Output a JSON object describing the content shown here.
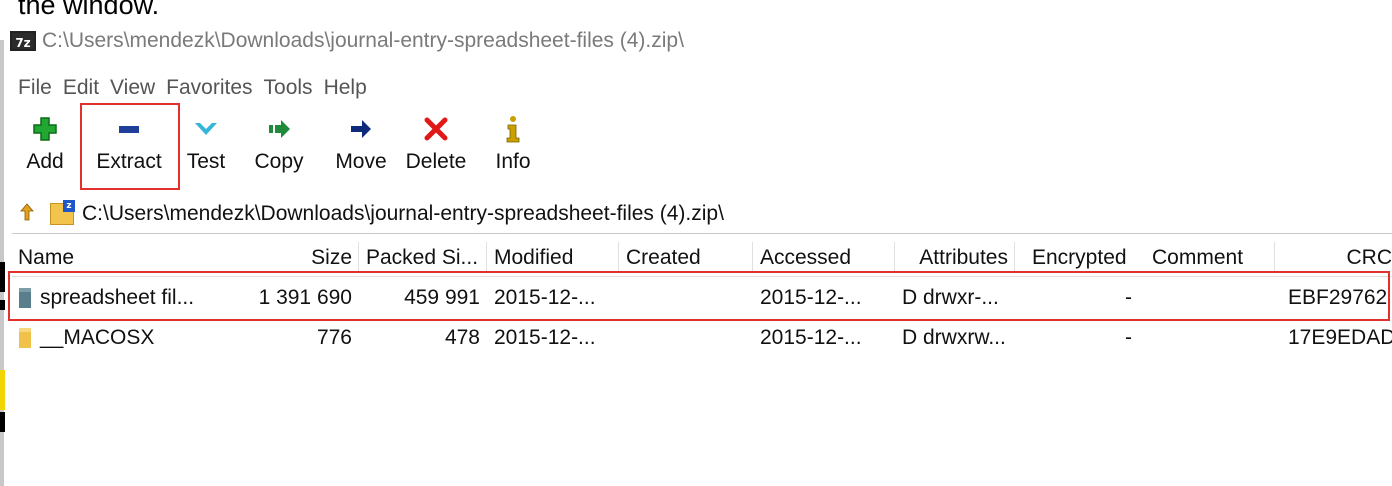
{
  "caption": "the window.",
  "window": {
    "app_icon_text": "7z",
    "title": "C:\\Users\\mendezk\\Downloads\\journal-entry-spreadsheet-files (4).zip\\"
  },
  "menu": [
    "File",
    "Edit",
    "View",
    "Favorites",
    "Tools",
    "Help"
  ],
  "toolbar": {
    "add": "Add",
    "extract": "Extract",
    "test": "Test",
    "copy": "Copy",
    "move": "Move",
    "delete": "Delete",
    "info": "Info"
  },
  "address": {
    "path": "C:\\Users\\mendezk\\Downloads\\journal-entry-spreadsheet-files (4).zip\\"
  },
  "columns": [
    "Name",
    "Size",
    "Packed Si...",
    "Modified",
    "Created",
    "Accessed",
    "Attributes",
    "Encrypted",
    "Comment",
    "CRC"
  ],
  "rows": [
    {
      "name": "spreadsheet fil...",
      "size": "1 391 690",
      "packed": "459 991",
      "modified": "2015-12-...",
      "created": "",
      "accessed": "2015-12-...",
      "attributes": "D drwxr-...",
      "encrypted": "-",
      "comment": "",
      "crc": "EBF29762"
    },
    {
      "name": "__MACOSX",
      "size": "776",
      "packed": "478",
      "modified": "2015-12-...",
      "created": "",
      "accessed": "2015-12-...",
      "attributes": "D drwxrw...",
      "encrypted": "-",
      "comment": "",
      "crc": "17E9EDAD"
    }
  ],
  "colors": {
    "highlight": "#e0312f",
    "add_icon": "#22a832",
    "extract_icon": "#1f3f9a",
    "test_icon": "#36b5d8",
    "copy_icon": "#1f8a3a",
    "move_icon": "#0e2a7a",
    "delete_icon": "#e01818",
    "info_icon": "#c9a000"
  }
}
